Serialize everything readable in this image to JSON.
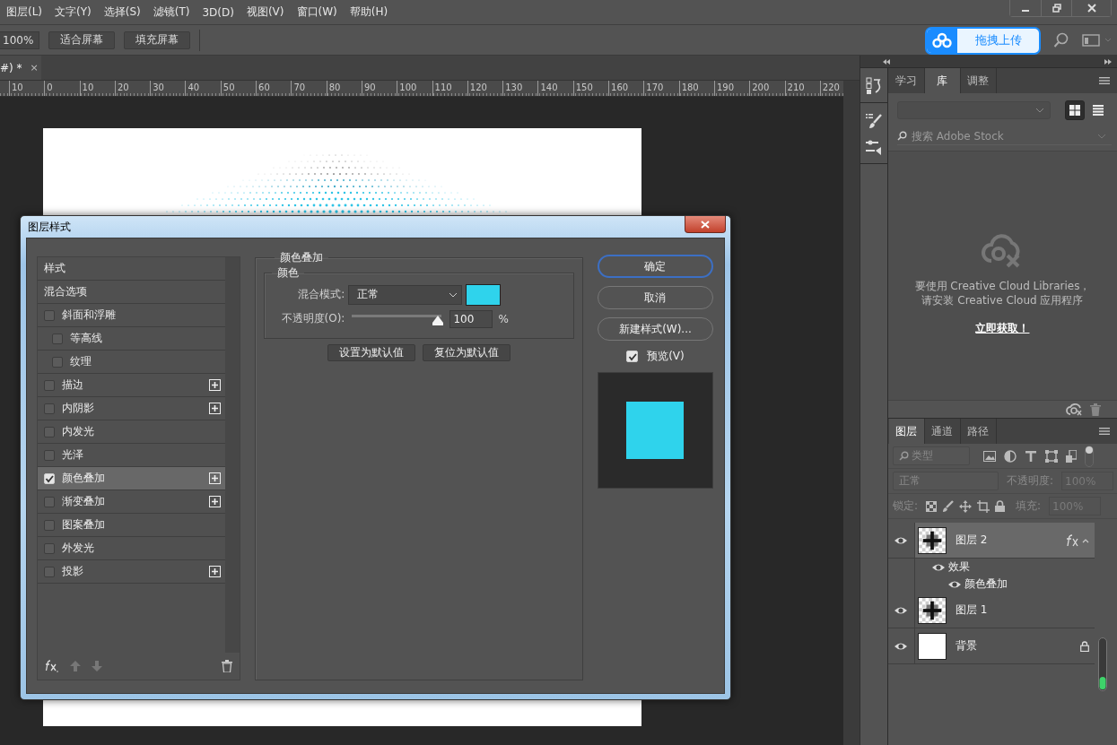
{
  "menu": [
    "图层(L)",
    "文字(Y)",
    "选择(S)",
    "滤镜(T)",
    "3D(D)",
    "视图(V)",
    "窗口(W)",
    "帮助(H)"
  ],
  "options_bar": {
    "zoom_value": "100%",
    "buttons": [
      "适合屏幕",
      "填充屏幕"
    ],
    "upload_button": "拖拽上传"
  },
  "document_tab": {
    "title": "#) *",
    "close": "×"
  },
  "ruler": [
    "10",
    "0",
    "10",
    "20",
    "30",
    "40",
    "50",
    "60",
    "70",
    "80",
    "90",
    "100",
    "110",
    "120",
    "130",
    "140",
    "150",
    "160",
    "170",
    "180",
    "190",
    "200",
    "210",
    "220"
  ],
  "layer_style_dialog": {
    "title": "图层样式",
    "styles": [
      {
        "label": "样式",
        "kind": "header",
        "selected": false
      },
      {
        "label": "混合选项",
        "kind": "header",
        "selected": false
      },
      {
        "label": "斜面和浮雕",
        "kind": "check",
        "checked": false,
        "selected": false,
        "addable": false,
        "children": [
          {
            "label": "等高线",
            "kind": "check",
            "checked": false,
            "selected": false,
            "addable": false
          },
          {
            "label": "纹理",
            "kind": "check",
            "checked": false,
            "selected": false,
            "addable": false
          }
        ]
      },
      {
        "label": "描边",
        "kind": "check",
        "checked": false,
        "selected": false,
        "addable": true
      },
      {
        "label": "内阴影",
        "kind": "check",
        "checked": false,
        "selected": false,
        "addable": true
      },
      {
        "label": "内发光",
        "kind": "check",
        "checked": false,
        "selected": false,
        "addable": false
      },
      {
        "label": "光泽",
        "kind": "check",
        "checked": false,
        "selected": false,
        "addable": false
      },
      {
        "label": "颜色叠加",
        "kind": "check",
        "checked": true,
        "selected": true,
        "addable": true
      },
      {
        "label": "渐变叠加",
        "kind": "check",
        "checked": false,
        "selected": false,
        "addable": true
      },
      {
        "label": "图案叠加",
        "kind": "check",
        "checked": false,
        "selected": false,
        "addable": false
      },
      {
        "label": "外发光",
        "kind": "check",
        "checked": false,
        "selected": false,
        "addable": false
      },
      {
        "label": "投影",
        "kind": "check",
        "checked": false,
        "selected": false,
        "addable": true
      }
    ],
    "color_overlay": {
      "title": "颜色叠加",
      "section": "颜色",
      "blend_label": "混合模式:",
      "blend_mode": "正常",
      "opacity_label": "不透明度(O):",
      "opacity": {
        "level": 1,
        "reading": "100",
        "unit": "%"
      },
      "buttons": [
        "设置为默认值",
        "复位为默认值"
      ]
    },
    "actions": [
      {
        "label": "确定",
        "default": true
      },
      {
        "label": "取消",
        "default": false
      },
      {
        "label": "新建样式(W)...",
        "default": false
      }
    ],
    "preview": {
      "label": "预览(V)",
      "checked": true
    }
  },
  "library_panel": {
    "tabs": [
      {
        "label": "学习",
        "selected": false
      },
      {
        "label": "库",
        "selected": true
      },
      {
        "label": "调整",
        "selected": false
      }
    ],
    "view_modes": [
      {
        "kind": "grid",
        "selected": true
      },
      {
        "kind": "list",
        "selected": false
      }
    ],
    "search_placeholder": "搜索 Adobe Stock",
    "message": [
      "要使用 Creative Cloud Libraries，",
      "请安装 Creative Cloud 应用程序"
    ],
    "link": "立即获取！"
  },
  "layers_panel": {
    "tabs": [
      {
        "label": "图层",
        "selected": true
      },
      {
        "label": "通道",
        "selected": false
      },
      {
        "label": "路径",
        "selected": false
      }
    ],
    "filter": "类型",
    "blend_mode": "正常",
    "opacity_label": "不透明度:",
    "opacity": "100%",
    "lock_label": "锁定:",
    "fill_label": "填充:",
    "fill": "100%",
    "layers": [
      {
        "name": "图层 2",
        "kind": "pattern",
        "selected": true,
        "visible": true,
        "fx": true,
        "locked": false,
        "effects_label": "效果",
        "effects": [
          "颜色叠加"
        ]
      },
      {
        "name": "图层 1",
        "kind": "pattern",
        "selected": false,
        "visible": true,
        "fx": false,
        "locked": false
      },
      {
        "name": "背景",
        "kind": "plain",
        "selected": false,
        "visible": true,
        "fx": false,
        "locked": true
      }
    ]
  }
}
